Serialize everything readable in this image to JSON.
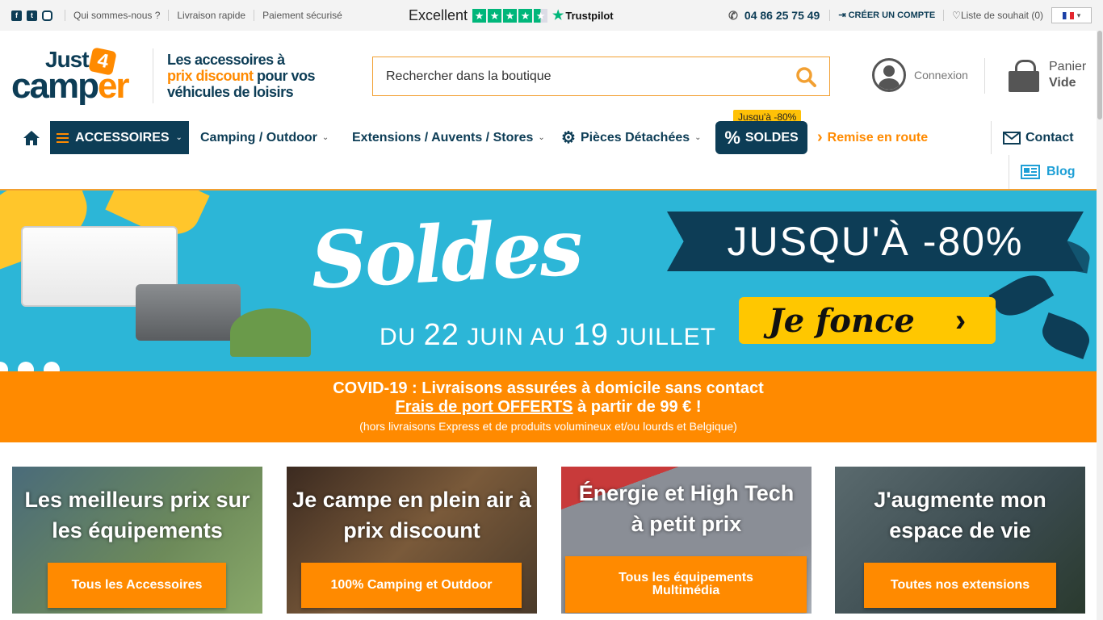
{
  "topbar": {
    "social": [
      "facebook-icon",
      "twitter-icon",
      "instagram-icon"
    ],
    "links": [
      "Qui sommes-nous ?",
      "Livraison rapide",
      "Paiement sécurisé"
    ],
    "trustpilot": {
      "rating_label": "Excellent",
      "stars": 4.5,
      "brand": "Trustpilot"
    },
    "phone": "04 86 25 75 49",
    "create_account": "CRÉER UN COMPTE",
    "wishlist": "Liste de souhait (0)",
    "language_icon": "french-flag-icon"
  },
  "header": {
    "logo": {
      "line1": "Just",
      "badge": "4",
      "line2a": "camp",
      "line2b": "er"
    },
    "tagline": {
      "l1": "Les accessoires à",
      "l2a": "prix discount",
      "l2b": " pour vos",
      "l3": "véhicules de loisirs"
    },
    "search_placeholder": "Rechercher dans la boutique",
    "login": "Connexion",
    "cart": {
      "label": "Panier",
      "status": "Vide"
    }
  },
  "nav": {
    "accessories": "ACCESSOIRES",
    "camping": "Camping / Outdoor",
    "extensions": "Extensions / Auvents / Stores",
    "pieces": "Pièces Détachées",
    "sales": "SOLDES",
    "sales_badge": "Jusqu'à -80%",
    "remise": "Remise en route",
    "contact": "Contact",
    "blog": "Blog"
  },
  "banner": {
    "title": "Soldes",
    "ribbon": "JUSQU'À -80%",
    "dates_prefix": "DU ",
    "dates_d1": "22",
    "dates_mid": " JUIN AU ",
    "dates_d2": "19",
    "dates_suffix": " JUILLET",
    "cta": "Je fonce",
    "slide_count": 3
  },
  "covid": {
    "line1": "COVID-19 : Livraisons assurées à domicile sans contact",
    "line2_link": "Frais de port OFFERTS",
    "line2_rest": " à partir de 99 € !",
    "line3": "(hors livraisons Express et de produits volumineux et/ou lourds et Belgique)"
  },
  "cards": [
    {
      "title": "Les meilleurs prix sur les équipements",
      "button": "Tous les Accessoires"
    },
    {
      "title": "Je campe en plein air à prix discount",
      "button": "100% Camping et Outdoor"
    },
    {
      "title": "Énergie et High Tech à petit prix",
      "button": "Tous les équipements Multimédia"
    },
    {
      "title": "J'augmente mon espace de vie",
      "button": "Toutes nos extensions"
    }
  ],
  "colors": {
    "brand_dark": "#0d3d56",
    "brand_orange": "#ff8a00",
    "banner_blue": "#2cb6d7",
    "trustpilot_green": "#00b67a"
  }
}
